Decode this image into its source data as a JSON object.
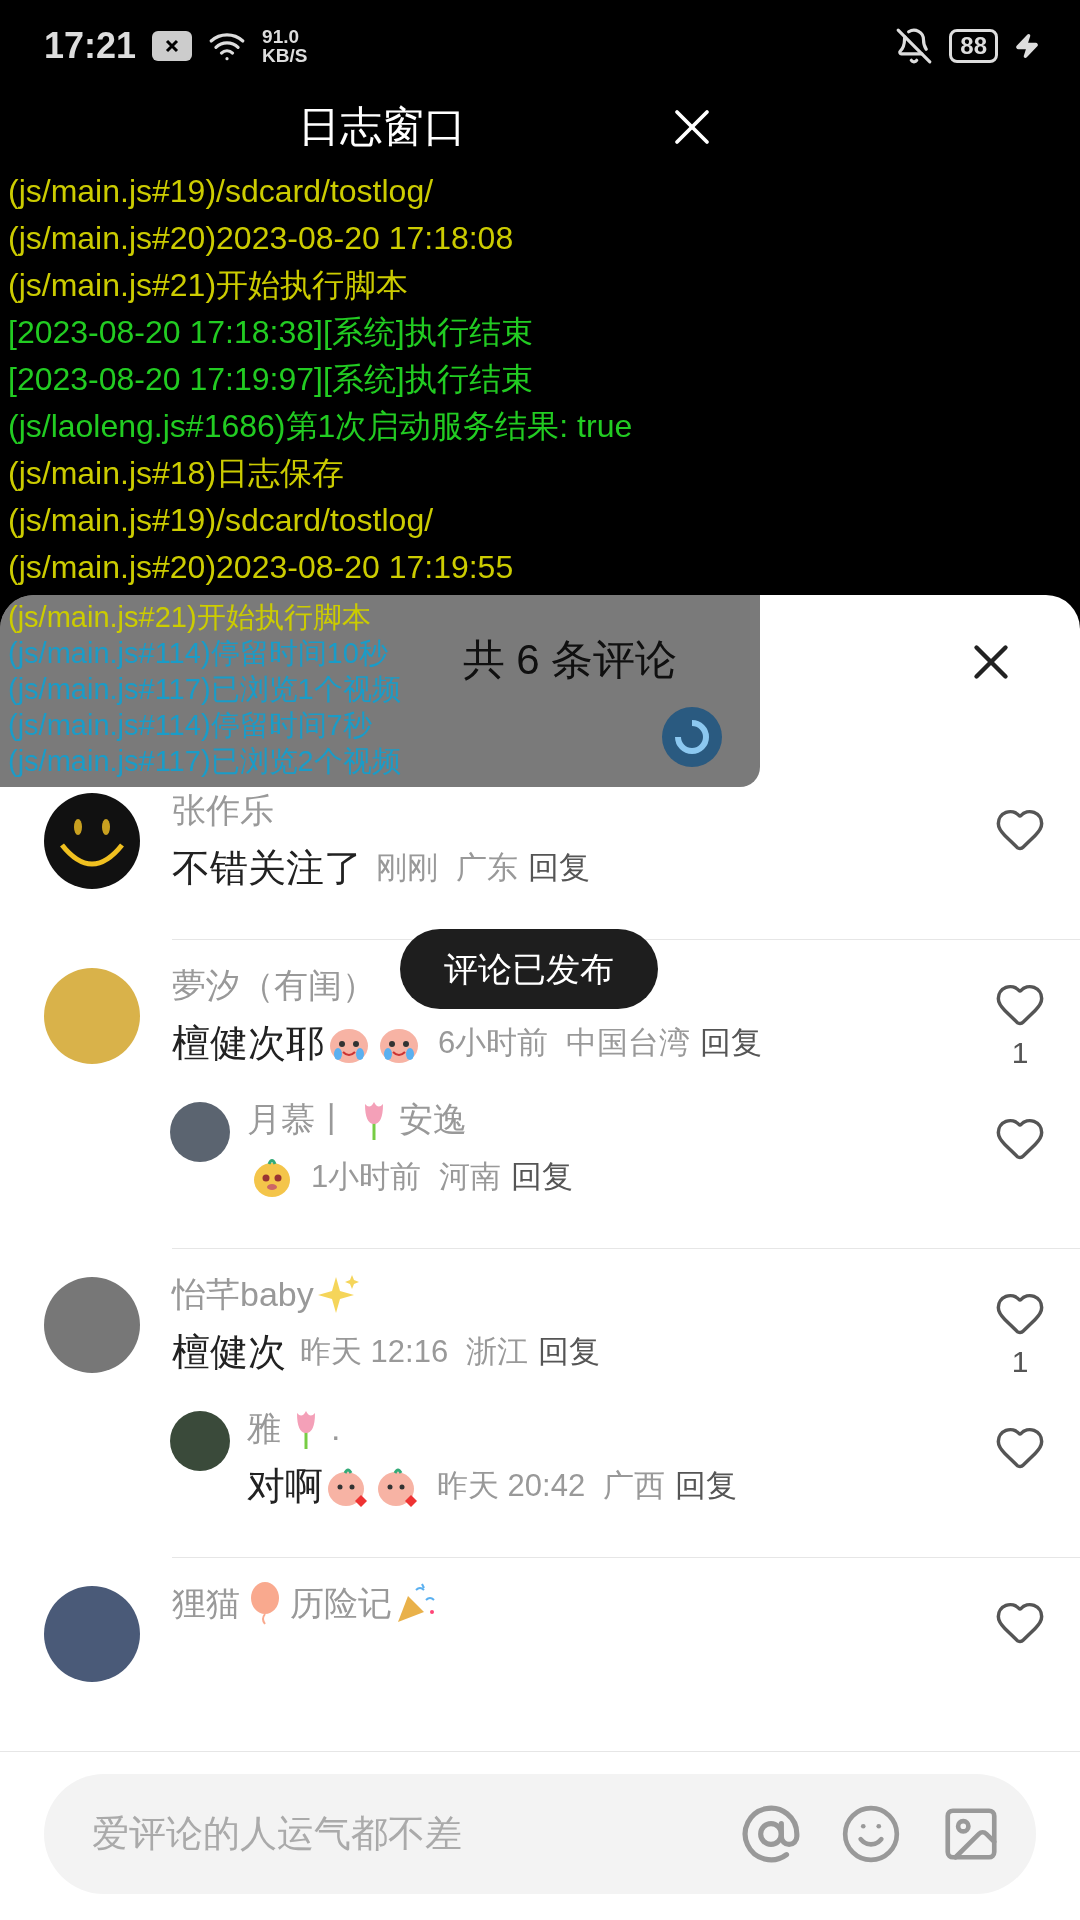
{
  "status_bar": {
    "time": "17:21",
    "net_speed": "91.0",
    "net_unit": "KB/S",
    "battery": "88"
  },
  "log_window": {
    "title": "日志窗口",
    "lines": [
      {
        "text": "(js/main.js#19)/sdcard/tostlog/",
        "color": "#cccc00"
      },
      {
        "text": "(js/main.js#20)2023-08-20 17:18:08",
        "color": "#cccc00"
      },
      {
        "text": "(js/main.js#21)开始执行脚本",
        "color": "#cccc00"
      },
      {
        "text": "[2023-08-20 17:18:38][系统]执行结束",
        "color": "#22cc22"
      },
      {
        "text": "[2023-08-20 17:19:97][系统]执行结束",
        "color": "#22cc22"
      },
      {
        "text": "(js/laoleng.js#1686)第1次启动服务结果: true",
        "color": "#22cc22"
      },
      {
        "text": "(js/main.js#18)日志保存",
        "color": "#cccc00"
      },
      {
        "text": "(js/main.js#19)/sdcard/tostlog/",
        "color": "#cccc00"
      },
      {
        "text": "(js/main.js#20)2023-08-20 17:19:55",
        "color": "#cccc00"
      }
    ],
    "overlay_lines": [
      {
        "text": "(js/main.js#21)开始执行脚本",
        "color": "#cccc00"
      },
      {
        "text": "(js/main.js#114)停留时间10秒",
        "color": "#1a9cc8"
      },
      {
        "text": "(js/main.js#117)已浏览1个视频",
        "color": "#1a9cc8"
      },
      {
        "text": "(js/main.js#114)停留时间7秒",
        "color": "#1a9cc8"
      },
      {
        "text": "(js/main.js#117)已浏览2个视频",
        "color": "#1a9cc8"
      }
    ]
  },
  "comments_sheet": {
    "title": "共 6 条评论",
    "toast": "评论已发布",
    "comments": [
      {
        "avatar": {
          "kind": "smiley"
        },
        "name": [
          {
            "kind": "text",
            "text": "张作乐"
          }
        ],
        "body": [
          {
            "kind": "text",
            "text": "不错关注了"
          }
        ],
        "time": "刚刚",
        "region": "广东",
        "reply": "回复"
      },
      {
        "avatar": {
          "kind": "photo"
        },
        "name": [
          {
            "kind": "text",
            "text": "夢汐（有闺）"
          }
        ],
        "body": [
          {
            "kind": "text",
            "text": "檀健次耶"
          },
          {
            "kind": "crying"
          },
          {
            "kind": "crying"
          }
        ],
        "time": "6小时前",
        "region": "中国台湾",
        "reply": "回复",
        "likes": "1",
        "replies": [
          {
            "avatar": {
              "kind": "photo"
            },
            "name": [
              {
                "kind": "text",
                "text": "月慕丨"
              },
              {
                "kind": "tulip"
              },
              {
                "kind": "text",
                "text": "安逸"
              }
            ],
            "body": [
              {
                "kind": "dog"
              }
            ],
            "time": "1小时前",
            "region": "河南",
            "reply": "回复"
          }
        ]
      },
      {
        "avatar": {
          "kind": "photo"
        },
        "name": [
          {
            "kind": "text",
            "text": "怡芊baby"
          },
          {
            "kind": "sparkles"
          }
        ],
        "body": [
          {
            "kind": "text",
            "text": "檀健次"
          }
        ],
        "time": "昨天 12:16",
        "region": "浙江",
        "reply": "回复",
        "likes": "1",
        "replies": [
          {
            "avatar": {
              "kind": "photo"
            },
            "name": [
              {
                "kind": "text",
                "text": "雅"
              },
              {
                "kind": "tulip"
              },
              {
                "kind": "text",
                "text": "."
              }
            ],
            "body": [
              {
                "kind": "text",
                "text": "对啊"
              },
              {
                "kind": "kissing"
              },
              {
                "kind": "kissing"
              }
            ],
            "time": "昨天 20:42",
            "region": "广西",
            "reply": "回复"
          }
        ]
      },
      {
        "avatar": {
          "kind": "photo"
        },
        "name": [
          {
            "kind": "text",
            "text": "狸猫"
          },
          {
            "kind": "balloon"
          },
          {
            "kind": "text",
            "text": "历险记"
          },
          {
            "kind": "party"
          }
        ]
      }
    ],
    "input": {
      "placeholder": "爱评论的人运气都不差"
    }
  }
}
